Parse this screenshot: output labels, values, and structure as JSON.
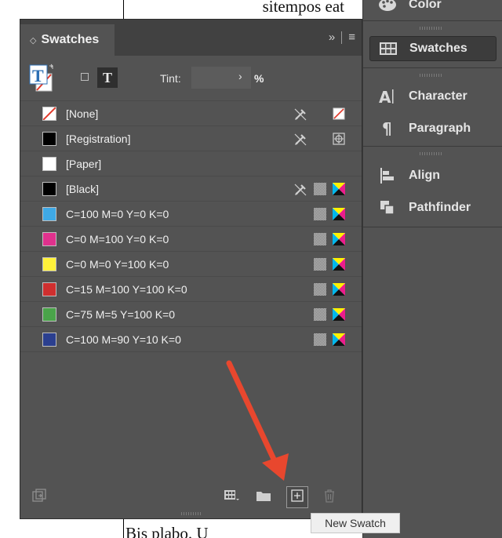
{
  "document": {
    "text_top": "sitempos eat",
    "text_bottom": "Bis plabo. U"
  },
  "dock": {
    "items": [
      {
        "label": "Color",
        "icon": "palette-icon"
      },
      {
        "label": "Swatches",
        "icon": "swatches-grid-icon",
        "active": true
      },
      {
        "label": "Character",
        "icon": "character-icon"
      },
      {
        "label": "Paragraph",
        "icon": "pilcrow-icon"
      },
      {
        "label": "Align",
        "icon": "align-icon"
      },
      {
        "label": "Pathfinder",
        "icon": "pathfinder-icon"
      }
    ]
  },
  "panel": {
    "tab_label": "Swatches",
    "collapse_glyph": "»",
    "menu_glyph": "≡",
    "tint_label": "Tint:",
    "tint_value": "",
    "tint_unit": "%",
    "text_toggle_glyph": "T"
  },
  "swatches": [
    {
      "name": "[None]",
      "color": "none",
      "icons": [
        "no-edit-icon",
        "none-type-icon"
      ]
    },
    {
      "name": "[Registration]",
      "color": "#000000",
      "icons": [
        "no-edit-icon",
        "registration-icon"
      ]
    },
    {
      "name": "[Paper]",
      "color": "#ffffff",
      "icons": []
    },
    {
      "name": "[Black]",
      "color": "#000000",
      "icons": [
        "no-edit-icon",
        "process-icon",
        "cmyk-icon"
      ]
    },
    {
      "name": "C=100 M=0 Y=0 K=0",
      "color": "#3fa9e6",
      "icons": [
        "process-icon",
        "cmyk-icon"
      ]
    },
    {
      "name": "C=0 M=100 Y=0 K=0",
      "color": "#e0318d",
      "icons": [
        "process-icon",
        "cmyk-icon"
      ]
    },
    {
      "name": "C=0 M=0 Y=100 K=0",
      "color": "#fff23a",
      "icons": [
        "process-icon",
        "cmyk-icon"
      ]
    },
    {
      "name": "C=15 M=100 Y=100 K=0",
      "color": "#cf2f2f",
      "icons": [
        "process-icon",
        "cmyk-icon"
      ]
    },
    {
      "name": "C=75 M=5 Y=100 K=0",
      "color": "#4aa44a",
      "icons": [
        "process-icon",
        "cmyk-icon"
      ]
    },
    {
      "name": "C=100 M=90 Y=10 K=0",
      "color": "#2b3f8f",
      "icons": [
        "process-icon",
        "cmyk-icon"
      ]
    }
  ],
  "bottom_bar": {
    "buttons": [
      {
        "name": "show-in-cc-libraries-button",
        "icon": "library-icon"
      },
      {
        "name": "show-swatch-kinds-button",
        "icon": "swatch-kinds-icon"
      },
      {
        "name": "new-color-group-button",
        "icon": "folder-icon"
      },
      {
        "name": "new-swatch-button",
        "icon": "new-swatch-icon",
        "hover": true
      },
      {
        "name": "delete-swatch-button",
        "icon": "trash-icon"
      }
    ]
  },
  "tooltip": {
    "text": "New Swatch"
  },
  "colors": {
    "annotation_arrow": "#e8472e",
    "panel_bg": "#535353",
    "titlebar_bg": "#414141"
  }
}
